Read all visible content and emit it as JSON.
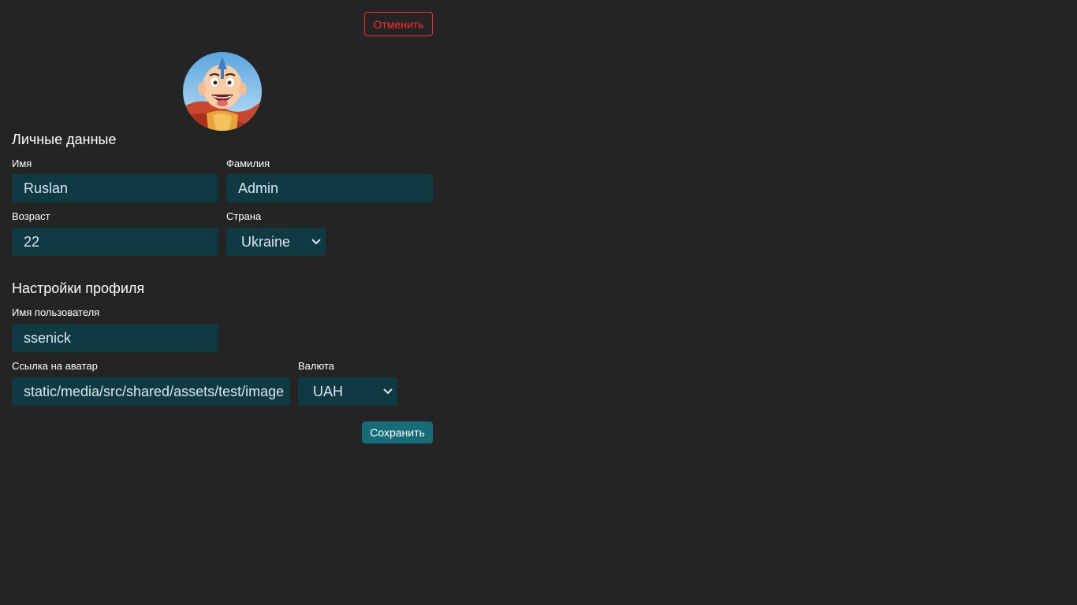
{
  "buttons": {
    "cancel": "Отменить",
    "save": "Сохранить"
  },
  "avatar": {
    "icon": "avatar-image"
  },
  "personal": {
    "title": "Личные данные",
    "first_name": {
      "label": "Имя",
      "value": "Ruslan"
    },
    "last_name": {
      "label": "Фамилия",
      "value": "Admin"
    },
    "age": {
      "label": "Возраст",
      "value": "22"
    },
    "country": {
      "label": "Страна",
      "value": "Ukraine"
    }
  },
  "profile": {
    "title": "Настройки профиля",
    "username": {
      "label": "Имя пользователя",
      "value": "ssenick"
    },
    "avatar_link": {
      "label": "Ссылка на аватар",
      "value": "static/media/src/shared/assets/test/image"
    },
    "currency": {
      "label": "Валюта",
      "value": "UAH"
    }
  },
  "colors": {
    "background": "#242424",
    "input_bg": "#0f3a44",
    "cancel_red": "#ff2f2f",
    "save_bg": "#176c7a"
  }
}
